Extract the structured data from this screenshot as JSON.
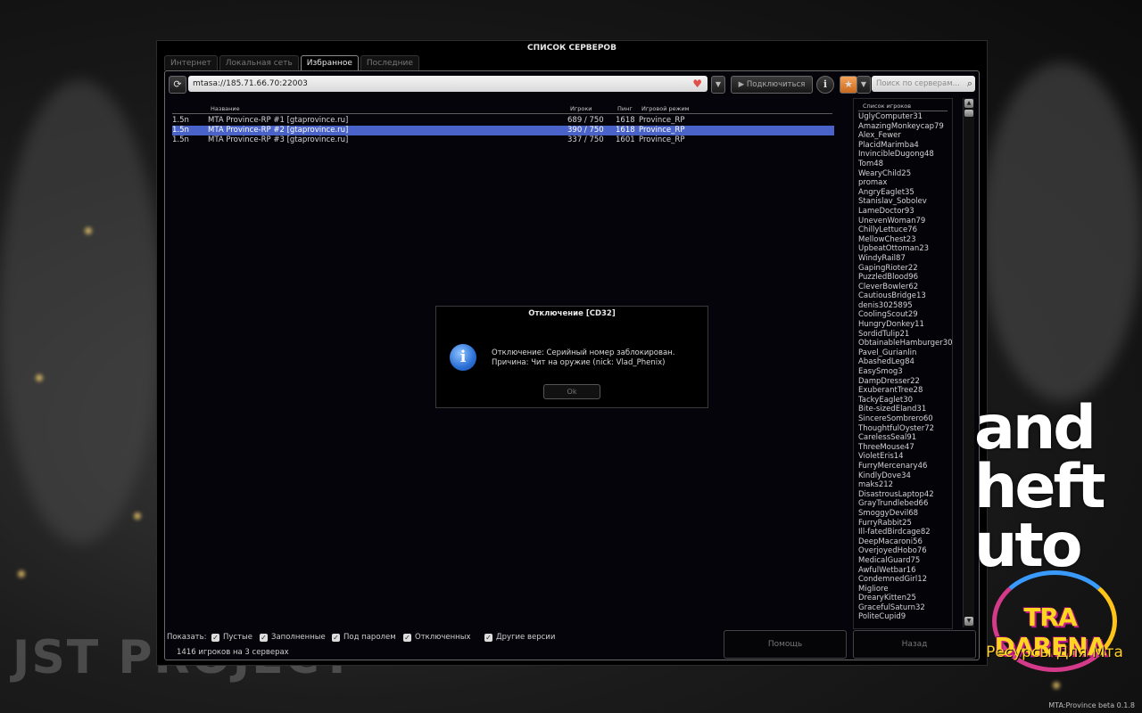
{
  "window": {
    "title": "СПИСОК СЕРВЕРОВ"
  },
  "tabs": [
    "Интернет",
    "Локальная сеть",
    "Избранное",
    "Последние"
  ],
  "active_tab": "Избранное",
  "toolbar": {
    "address": "mtasa://185.71.66.70:22003",
    "connect_label": "Подключиться",
    "search_placeholder": "Поиск по серверам..."
  },
  "columns": {
    "name": "Название",
    "players": "Игроки",
    "ping": "Пинг",
    "gamemode": "Игровой режим"
  },
  "servers": [
    {
      "version": "1.5n",
      "name": "MTA Province-RP #1  [gtaprovince.ru]",
      "players": "689 / 750",
      "ping": "1618",
      "gamemode": "Province_RP",
      "selected": false
    },
    {
      "version": "1.5n",
      "name": "MTA Province-RP #2  [gtaprovince.ru]",
      "players": "390 / 750",
      "ping": "1618",
      "gamemode": "Province_RP",
      "selected": true
    },
    {
      "version": "1.5n",
      "name": "MTA Province-RP #3  [gtaprovince.ru]",
      "players": "337 / 750",
      "ping": "1601",
      "gamemode": "Province_RP",
      "selected": false
    }
  ],
  "players_panel": {
    "title": "Список игроков",
    "players": [
      "UglyComputer31",
      "AmazingMonkeycap79",
      "Alex_Fewer",
      "PlacidMarimba4",
      "InvincibleDugong48",
      "Tom48",
      "WearyChild25",
      "promax",
      "AngryEaglet35",
      "Stanislav_Sobolev",
      "LameDoctor93",
      "UnevenWoman79",
      "ChillyLettuce76",
      "MellowChest23",
      "UpbeatOttoman23",
      "WindyRail87",
      "GapingRioter22",
      "PuzzledBlood96",
      "CleverBowler62",
      "CautiousBridge13",
      "denis3025895",
      "CoolingScout29",
      "HungryDonkey11",
      "SordidTulip21",
      "ObtainableHamburger30",
      "Pavel_Gurianlin",
      "AbashedLeg84",
      "EasySmog3",
      "DampDresser22",
      "ExuberantTree28",
      "TackyEaglet30",
      "Bite-sizedEland31",
      "SincereSombrero60",
      "ThoughtfulOyster72",
      "CarelessSeal91",
      "ThreeMouse47",
      "VioletEris14",
      "FurryMercenary46",
      "KindlyDove34",
      "maks212",
      "DisastrousLaptop42",
      "GrayTrundlebed66",
      "SmoggyDevil68",
      "FurryRabbit25",
      "Ill-fatedBirdcage82",
      "DeepMacaroni56",
      "OverjoyedHobo76",
      "MedicalGuard75",
      "AwfulWetbar16",
      "CondemnedGirl12",
      "Migliore",
      "DrearyKitten25",
      "GracefulSaturn32",
      "PoliteCupid9"
    ]
  },
  "filters": {
    "label": "Показать:",
    "items": [
      {
        "label": "Пустые",
        "checked": true
      },
      {
        "label": "Заполненные",
        "checked": true
      },
      {
        "label": "Под паролем",
        "checked": true
      },
      {
        "label": "Отключенных",
        "checked": true
      },
      {
        "label": "Другие версии",
        "checked": true
      }
    ]
  },
  "status": "1416 игроков на 3 серверах",
  "buttons": {
    "help": "Помощь",
    "back": "Назад"
  },
  "dialog": {
    "title": "Отключение [CD32]",
    "line1": "Отключение: Серийный номер заблокирован.",
    "line2": "Причина: Чит на оружие (nick: Vlad_Phenix)",
    "ok": "Ok"
  },
  "overlay": {
    "left_watermark": "JST PROJECT",
    "gta_logo": [
      "and",
      "heft",
      "uto"
    ],
    "brand_name": "TRA DARENA",
    "brand_sub": "Ресурсы Для Мта",
    "version": "MTA:Province beta 0.1.8"
  },
  "colors": {
    "selection": "#4a63c8",
    "brand_yellow": "#ffd520",
    "brand_pink": "#c2188a",
    "heart": "#e0504a"
  }
}
